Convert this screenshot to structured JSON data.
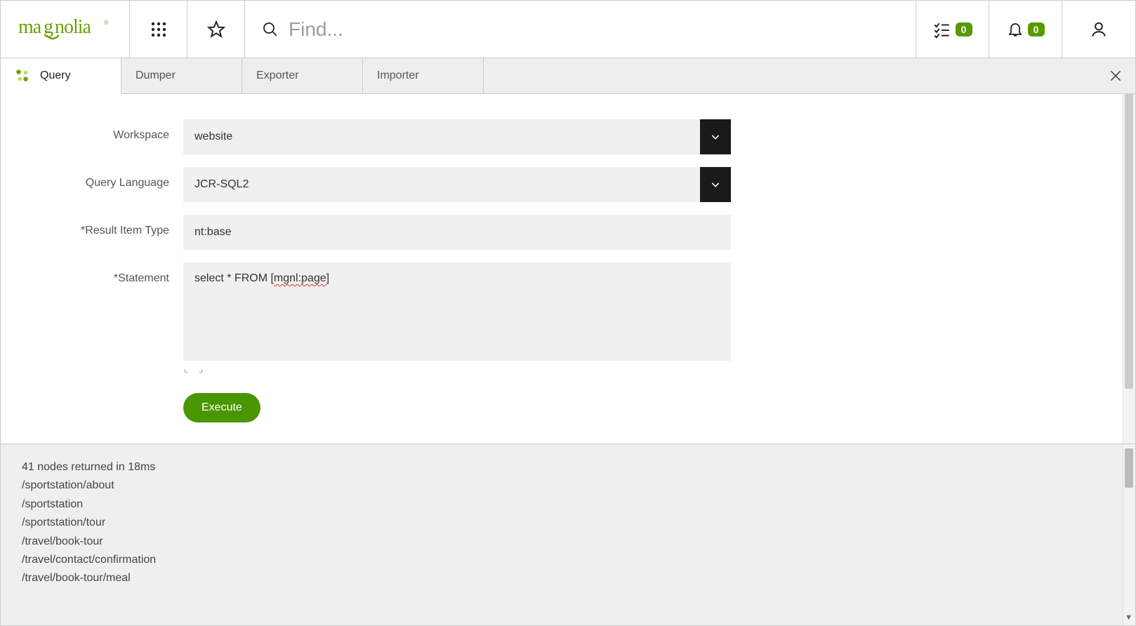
{
  "header": {
    "logo_text": "magnolia",
    "search_placeholder": "Find...",
    "tasks_count": "0",
    "notifications_count": "0"
  },
  "tabs": {
    "items": [
      {
        "label": "Query"
      },
      {
        "label": "Dumper"
      },
      {
        "label": "Exporter"
      },
      {
        "label": "Importer"
      }
    ]
  },
  "form": {
    "workspace": {
      "label": "Workspace",
      "value": "website"
    },
    "language": {
      "label": "Query Language",
      "value": "JCR-SQL2"
    },
    "result_type": {
      "label": "*Result Item Type",
      "value": "nt:base"
    },
    "statement": {
      "label": "*Statement",
      "prefix": "select * FROM [",
      "highlighted": "mgnl:page",
      "suffix": "]"
    },
    "execute_label": "Execute"
  },
  "results": {
    "summary": "41 nodes returned in 18ms",
    "rows": [
      "/sportstation/about",
      "/sportstation",
      "/sportstation/tour",
      "/travel/book-tour",
      "/travel/contact/confirmation",
      "/travel/book-tour/meal"
    ]
  }
}
